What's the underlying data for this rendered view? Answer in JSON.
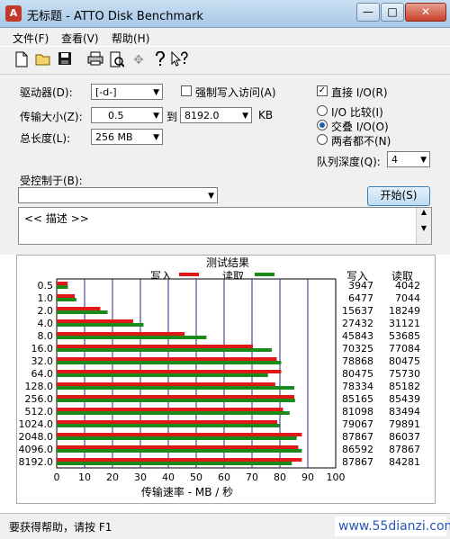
{
  "window": {
    "title": "无标题 - ATTO Disk Benchmark",
    "app_icon": "atto-icon",
    "controls": {
      "minimize": "—",
      "maximize": "□",
      "close": "✕"
    }
  },
  "menu": [
    "文件(F)",
    "查看(V)",
    "帮助(H)"
  ],
  "toolbar": [
    "new-file-icon",
    "open-file-icon",
    "save-icon",
    "print-icon",
    "print-preview-icon",
    "move-icon",
    "help-icon",
    "context-help-icon"
  ],
  "form": {
    "drive_label": "驱动器(D):",
    "drive_value": "[-d-]",
    "force_write_label": "强制写入访问(A)",
    "force_write_checked": false,
    "direct_io_label": "直接 I/O(R)",
    "direct_io_checked": true,
    "transfer_size_label": "传输大小(Z):",
    "transfer_from": "0.5",
    "to_label": "到",
    "transfer_to": "8192.0",
    "kb_label": "KB",
    "io_compare_label": "I/O 比较(I)",
    "overlapped_io_label": "交叠 I/O(O)",
    "neither_label": "两者都不(N)",
    "selected_io_mode": "交叠 I/O(O)",
    "total_length_label": "总长度(L):",
    "total_length_value": "256 MB",
    "queue_depth_label": "队列深度(Q):",
    "queue_depth_value": "4",
    "controlled_by_label": "受控制于(B):",
    "controlled_by_value": "",
    "start_button": "开始(S)",
    "description": "<< 描述 >>"
  },
  "results": {
    "write_header": "写入",
    "read_header": "读取"
  },
  "chart_data": {
    "type": "bar",
    "orientation": "horizontal",
    "title": "测试结果",
    "xlabel": "传输速率 - MB / 秒",
    "xlim": [
      0,
      100
    ],
    "xticks": [
      "0",
      "10",
      "20",
      "30",
      "40",
      "50",
      "60",
      "70",
      "80",
      "90",
      "100"
    ],
    "categories": [
      "0.5",
      "1.0",
      "2.0",
      "4.0",
      "8.0",
      "16.0",
      "32.0",
      "64.0",
      "128.0",
      "256.0",
      "512.0",
      "1024.0",
      "2048.0",
      "4096.0",
      "8192.0"
    ],
    "series": [
      {
        "name": "写入",
        "color": "#e01818",
        "values": [
          3.947,
          6.477,
          15.637,
          27.432,
          45.843,
          70.325,
          78.868,
          80.475,
          78.334,
          85.165,
          81.098,
          79.067,
          87.867,
          86.592,
          87.867
        ],
        "labels": [
          "3947",
          "6477",
          "15637",
          "27432",
          "45843",
          "70325",
          "78868",
          "80475",
          "78334",
          "85165",
          "81098",
          "79067",
          "87867",
          "86592",
          "87867"
        ]
      },
      {
        "name": "读取",
        "color": "#1a8a1a",
        "values": [
          4.042,
          7.044,
          18.249,
          31.121,
          53.685,
          77.084,
          80.475,
          75.73,
          85.182,
          85.439,
          83.494,
          79.891,
          86.037,
          87.867,
          84.281
        ],
        "labels": [
          "4042",
          "7044",
          "18249",
          "31121",
          "53685",
          "77084",
          "80475",
          "75730",
          "85182",
          "85439",
          "83494",
          "79891",
          "86037",
          "87867",
          "84281"
        ]
      }
    ],
    "grid": true,
    "legend": "top"
  },
  "status_bar": {
    "text": "要获得帮助，请按 F1",
    "watermark": "www.55dianzi.com"
  }
}
